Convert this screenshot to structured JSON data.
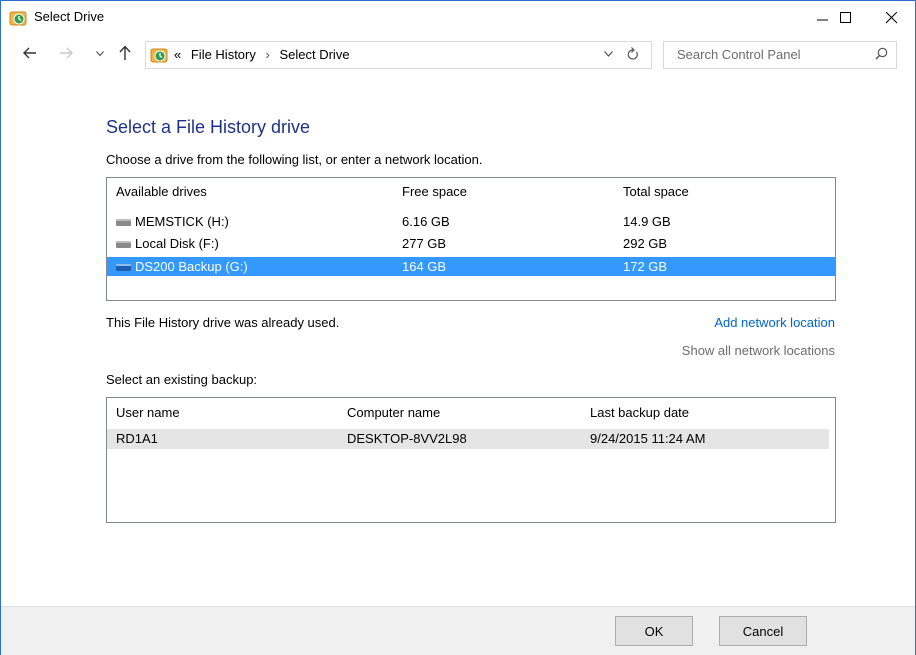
{
  "window": {
    "title": "Select Drive"
  },
  "titlebar": {
    "minimize": "—",
    "maximize": "☐",
    "close": "✕"
  },
  "nav": {
    "back_icon": "back-arrow-icon",
    "forward_icon": "forward-arrow-icon",
    "up_icon": "up-arrow-icon",
    "breadcrumb_prefix": "«",
    "breadcrumbs": [
      "File History",
      "Select Drive"
    ],
    "separator": "›",
    "search_placeholder": "Search Control Panel"
  },
  "main": {
    "heading": "Select a File History drive",
    "instruction": "Choose a drive from the following list, or enter a network location.",
    "drives_table": {
      "columns": [
        "Available drives",
        "Free space",
        "Total space"
      ],
      "rows": [
        {
          "name": "MEMSTICK (H:)",
          "free": "6.16 GB",
          "total": "14.9 GB",
          "selected": false
        },
        {
          "name": "Local Disk (F:)",
          "free": "277 GB",
          "total": "292 GB",
          "selected": false
        },
        {
          "name": "DS200 Backup (G:)",
          "free": "164 GB",
          "total": "172 GB",
          "selected": true
        }
      ]
    },
    "used_message": "This File History drive was already used.",
    "add_network_link": "Add network location",
    "show_network_link": "Show all network locations",
    "backup_heading": "Select an existing backup:",
    "backups_table": {
      "columns": [
        "User name",
        "Computer name",
        "Last backup date"
      ],
      "rows": [
        {
          "user": "RD1A1",
          "computer": "DESKTOP-8VV2L98",
          "date": "9/24/2015 11:24 AM"
        }
      ]
    }
  },
  "footer": {
    "ok": "OK",
    "cancel": "Cancel"
  },
  "colors": {
    "heading": "#1e3287",
    "selection": "#3399ff",
    "link": "#0066cc"
  }
}
